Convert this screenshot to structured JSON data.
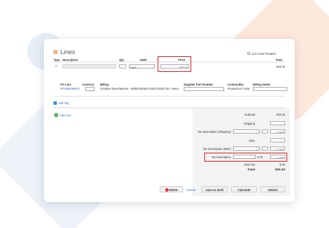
{
  "header": {
    "title": "Lines",
    "line_level_taxation_label": "Line Level Taxation"
  },
  "line_table": {
    "columns": {
      "type": "Type",
      "description": "Description",
      "qty": "Qty",
      "uom": "UOM",
      "price": "Price",
      "total": "Total"
    },
    "row": {
      "qty": "1",
      "uom": "Each",
      "price": "600.00",
      "total": "600.00"
    }
  },
  "po_section": {
    "columns": {
      "po_line": "PO Line",
      "contract": "Contract",
      "billing": "Billing",
      "supplier_part": "Supplier Part Number",
      "commodity": "Commodity",
      "billing_notes": "Billing Notes"
    },
    "row": {
      "po_line": "EPU5050966-1",
      "billing": "Creative Development - 60500.60000-14001-0000-US---None",
      "commodity": "Production Costs"
    }
  },
  "actions": {
    "add_tag": "Add Tag",
    "add_line": "Add Line"
  },
  "summary": {
    "subtotal_label": "Subtotal",
    "subtotal_value": "600.00",
    "shipping_label": "Shipping",
    "tax_shipping_label": "Tax Description (Shipping)",
    "tax_shipping_amount": "0.000",
    "misc_label": "Misc",
    "tax_misc_label": "Tax Description (Misc)",
    "tax_misc_amount": "0.000",
    "tax_label": "Tax Description",
    "tax_rate": "0.00",
    "tax_amount": "0.000",
    "total_tax_label": "Total Tax",
    "total_tax_value": "0.00",
    "total_label": "Total",
    "total_value": "600.00"
  },
  "footer": {
    "delete": "Delete",
    "cancel": "Cancel",
    "save_draft": "Save as draft",
    "calculate": "Calculate",
    "submit": "Submit"
  },
  "colors": {
    "highlight": "#e0161e",
    "link": "#2a6ebb",
    "add": "#3aa84a",
    "accent": "#f3b07a"
  }
}
